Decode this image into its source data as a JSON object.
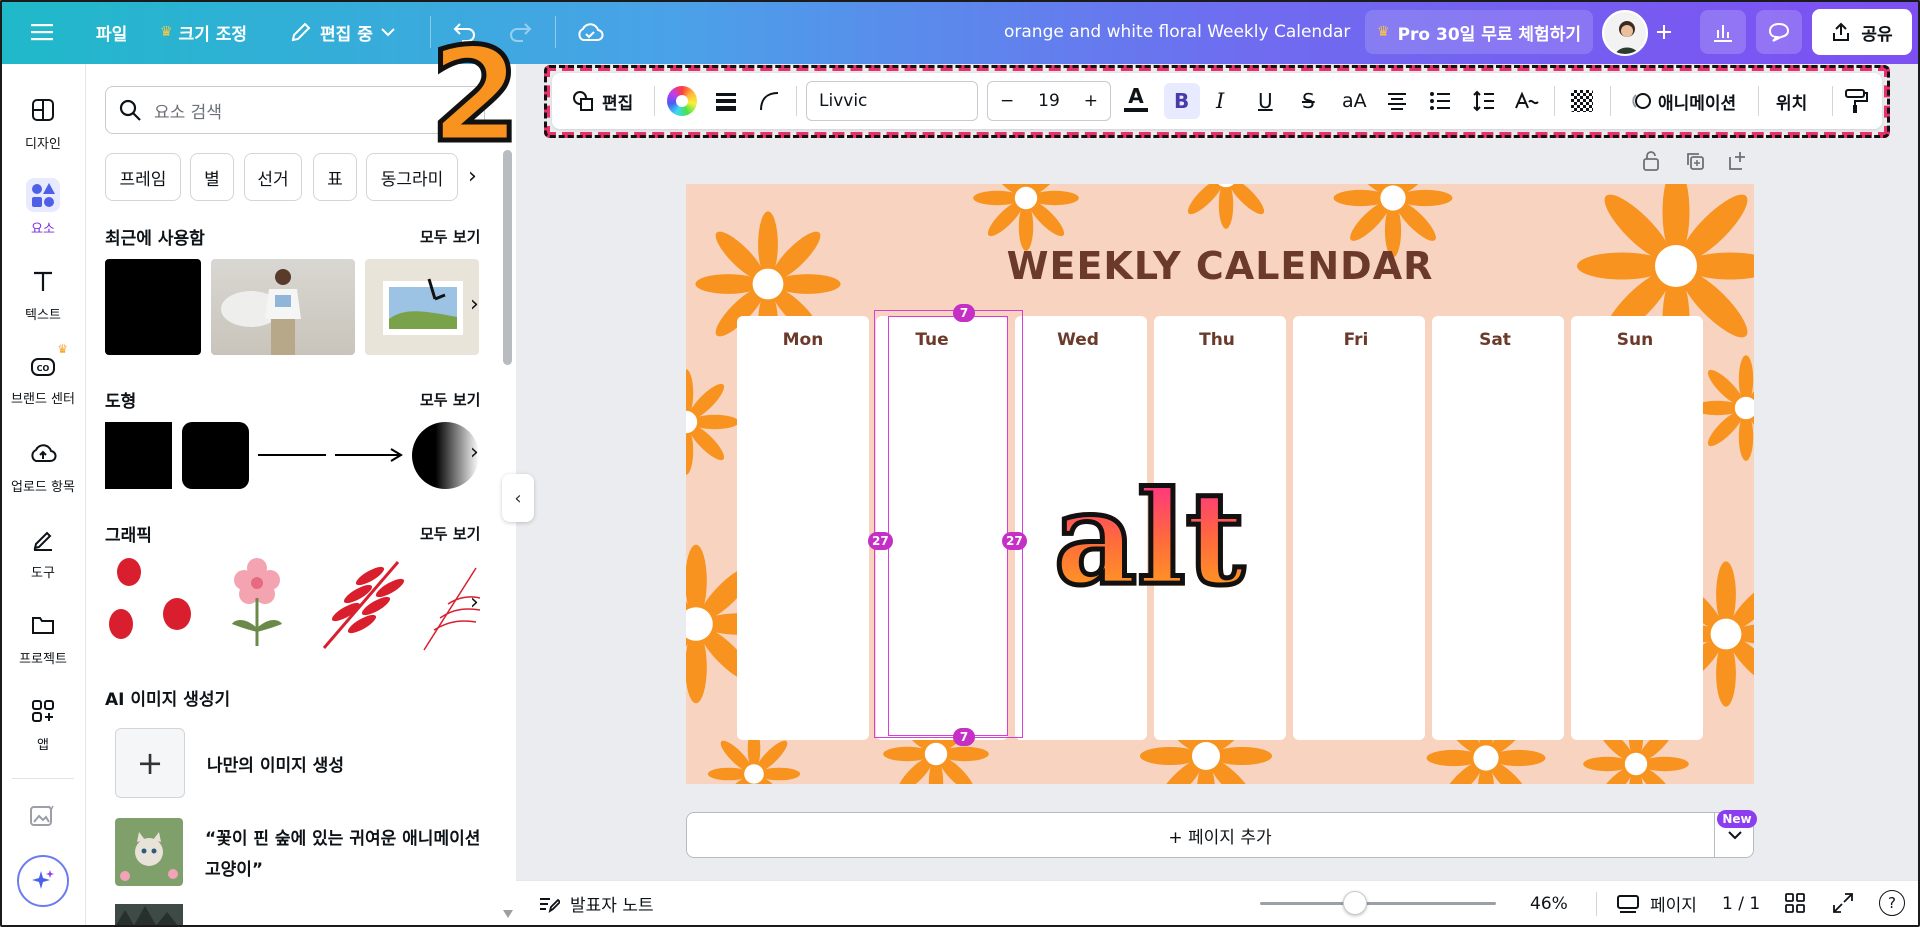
{
  "topbar": {
    "file": "파일",
    "resize": "크기 조정",
    "edit_mode": "편집 중",
    "doc_title": "orange and white floral Weekly Calendar",
    "pro_trial": "Pro 30일 무료 체험하기",
    "share": "공유",
    "icons": [
      "menu-icon",
      "crown-icon",
      "pencil-icon",
      "chevron-down-icon",
      "undo-icon",
      "redo-icon",
      "cloud-check-icon",
      "plus-icon",
      "analytics-icon",
      "comment-icon",
      "upload-icon"
    ]
  },
  "rail": {
    "items": [
      {
        "label": "디자인",
        "icon": "design-icon"
      },
      {
        "label": "요소",
        "icon": "elements-icon",
        "active": true
      },
      {
        "label": "텍스트",
        "icon": "text-icon"
      },
      {
        "label": "브랜드 센터",
        "icon": "brand-icon"
      },
      {
        "label": "업로드 항목",
        "icon": "upload-cloud-icon"
      },
      {
        "label": "도구",
        "icon": "draw-icon"
      },
      {
        "label": "프로젝트",
        "icon": "folder-icon"
      },
      {
        "label": "앱",
        "icon": "apps-icon"
      }
    ]
  },
  "panel": {
    "search_placeholder": "요소 검색",
    "chips": [
      "프레임",
      "별",
      "선거",
      "표",
      "동그라미"
    ],
    "recent": {
      "title": "최근에 사용함",
      "see_all": "모두 보기"
    },
    "shapes": {
      "title": "도형",
      "see_all": "모두 보기"
    },
    "graphics": {
      "title": "그래픽",
      "see_all": "모두 보기"
    },
    "ai": {
      "title": "AI 이미지 생성기",
      "create": "나만의 이미지 생성",
      "prompt_line1": "“꽃이 핀 숲에 있는 귀여운 애니메이션",
      "prompt_line2": "고양이”"
    }
  },
  "toolbar": {
    "edit": "편집",
    "font": "Livvic",
    "size": "19",
    "minus": "−",
    "plus": "+",
    "case": "aA",
    "animate": "애니메이션",
    "position": "위치"
  },
  "annotation": {
    "step": "2"
  },
  "canvas": {
    "title": "WEEKLY CALENDAR",
    "days": [
      "Mon",
      "Tue",
      "Wed",
      "Thu",
      "Fri",
      "Sat",
      "Sun"
    ],
    "overlay_text": "alt",
    "handles": {
      "top": "7",
      "bottom": "7",
      "left": "27",
      "right": "27"
    }
  },
  "add_page": {
    "label": "+ 페이지 추가",
    "badge": "New"
  },
  "bottombar": {
    "notes": "발표자 노트",
    "zoom": "46%",
    "pages_label": "페이지",
    "page_count": "1 / 1",
    "help": "?"
  },
  "colors": {
    "accent": "#7d2ae8",
    "canvas_bg": "#f8d4c0",
    "flower": "#f7931e",
    "title_brown": "#6b3a2a",
    "selection": "#c52fc5",
    "annotation_dash": "#e8306b"
  }
}
